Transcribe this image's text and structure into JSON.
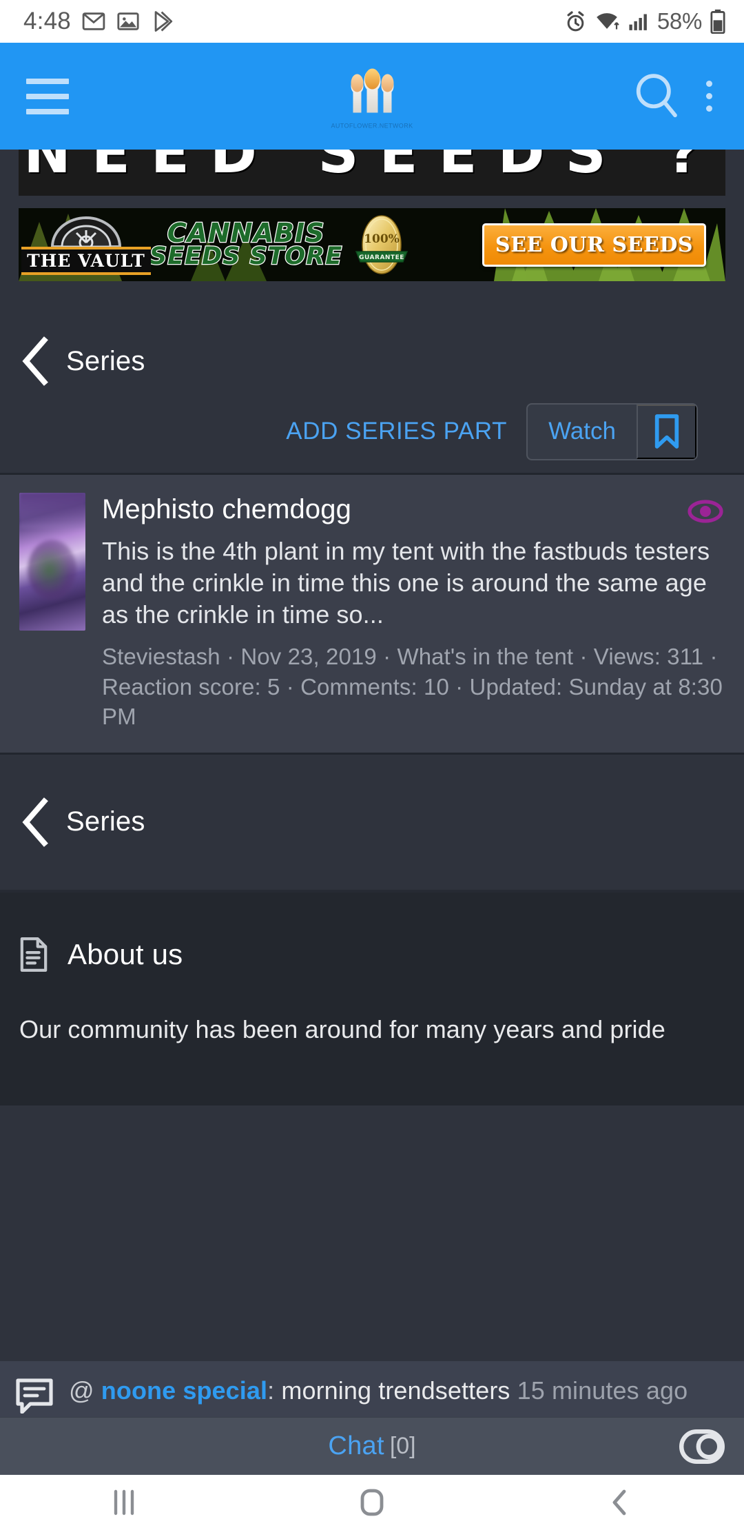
{
  "status_bar": {
    "time": "4:48",
    "battery_percent": "58%",
    "icons": [
      "gmail-icon",
      "photos-icon",
      "play-store-icon",
      "alarm-icon",
      "wifi-icon",
      "signal-icon",
      "battery-icon"
    ]
  },
  "app_header": {
    "menu_icon": "hamburger-menu-icon",
    "logo_tagline": "AUTOFLOWER.NETWORK",
    "search_icon": "search-icon",
    "overflow_icon": "kebab-menu-icon",
    "background_color": "#2196f3"
  },
  "ad": {
    "top_text": "NEED SEEDS ?",
    "brand": "THE VAULT",
    "headline_line1": "CANNABIS",
    "headline_line2": "SEEDS STORE",
    "guarantee_percent": "100%",
    "guarantee_label": "GUARANTEE",
    "cta": "SEE OUR SEEDS"
  },
  "series_nav": {
    "back_icon": "chevron-left-icon",
    "label": "Series"
  },
  "actions": {
    "add_series_part": "ADD SERIES PART",
    "watch": "Watch",
    "bookmark_icon": "bookmark-icon"
  },
  "thread": {
    "title": "Mephisto chemdogg",
    "snippet": "This is the 4th plant in my tent with the fastbuds testers and the crinkle in time this one is around the same age as the crinkle in time so...",
    "meta": "Steviestash · Nov 23, 2019 · What's in the tent · Views: 311 · Reaction score: 5 · Comments: 10 · Updated: Sunday at 8:30 PM",
    "author": "Steviestash",
    "date": "Nov 23, 2019",
    "forum": "What's in the tent",
    "views": "311",
    "reaction_score": "5",
    "comments": "10",
    "updated": "Sunday at 8:30 PM",
    "watched_icon": "eye-icon",
    "watched_icon_color": "#9b2496",
    "thumbnail": "plant-thumbnail"
  },
  "series_nav_bottom": {
    "back_icon": "chevron-left-icon",
    "label": "Series"
  },
  "about": {
    "icon": "document-icon",
    "title": "About us",
    "text": "Our community has been around for many years and pride"
  },
  "chat_notice": {
    "icon": "chat-bubble-icon",
    "at": "@",
    "user": "noone special",
    "separator": ":",
    "message": "morning trendsetters",
    "time": "15 minutes ago"
  },
  "chat_bar": {
    "label": "Chat",
    "count": "[0]",
    "toggle_icon": "toggle-switch-icon"
  },
  "android_nav": {
    "recents_icon": "recents-icon",
    "home_icon": "home-icon",
    "back_icon": "back-icon"
  }
}
